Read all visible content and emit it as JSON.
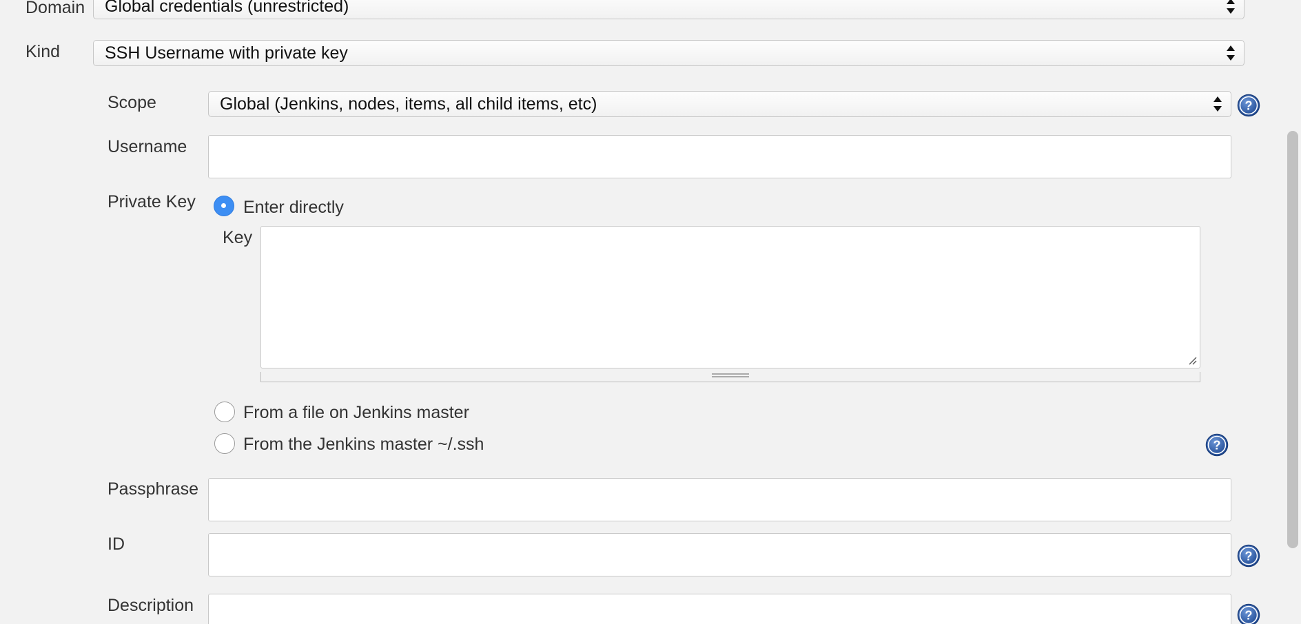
{
  "domain": {
    "label": "Domain",
    "value": "Global credentials (unrestricted)"
  },
  "kind": {
    "label": "Kind",
    "value": "SSH Username with private key"
  },
  "scope": {
    "label": "Scope",
    "value": "Global (Jenkins, nodes, items, all child items, etc)"
  },
  "username": {
    "label": "Username",
    "value": ""
  },
  "private_key": {
    "label": "Private Key",
    "options": [
      {
        "label": "Enter directly",
        "selected": true
      },
      {
        "label": "From a file on Jenkins master",
        "selected": false
      },
      {
        "label": "From the Jenkins master ~/.ssh",
        "selected": false
      }
    ],
    "key_label": "Key",
    "key_value": ""
  },
  "passphrase": {
    "label": "Passphrase",
    "value": ""
  },
  "id": {
    "label": "ID",
    "value": ""
  },
  "description": {
    "label": "Description",
    "value": ""
  },
  "icons": {
    "help": "help-icon",
    "select_arrows": "updown-arrows-icon"
  },
  "colors": {
    "background": "#f2f2f2",
    "radio_selected": "#3d8ef3",
    "help_icon": "#2d5aa8"
  }
}
